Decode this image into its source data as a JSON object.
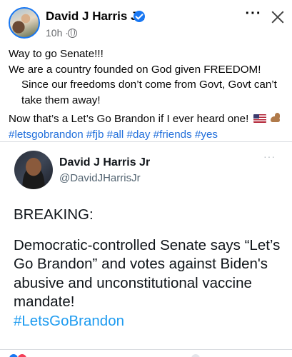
{
  "post": {
    "author": "David J Harris Jr.",
    "time": "10h ·",
    "lines": [
      "Way to go Senate!!!",
      "We are a country founded on God given FREEDOM!",
      "Since our freedoms don’t come from Govt, Govt can’t take them away!",
      "Now that’s a Let’s Go Brandon if I ever heard one!"
    ],
    "hashtags": "#letsgobrandon #fjb #all #day #friends #yes",
    "icons": {
      "verified": "verified-badge",
      "privacy": "globe-icon",
      "more": "more-icon",
      "close": "close-icon",
      "flag": "us-flag-emoji",
      "arm": "flexed-biceps-emoji"
    },
    "colors": {
      "hashtag": "#216fdb",
      "verified": "#1877f2"
    }
  },
  "tweet": {
    "name": "David J Harris Jr",
    "handle": "@DavidJHarrisJr",
    "heading": "BREAKING:",
    "body": "Democratic-controlled Senate says “Let’s Go Brandon” and votes against Biden's abusive and unconstitutional vaccine mandate!",
    "hashtag": "#LetsGoBrandon",
    "colors": {
      "hashtag": "#1d9bf0"
    }
  }
}
